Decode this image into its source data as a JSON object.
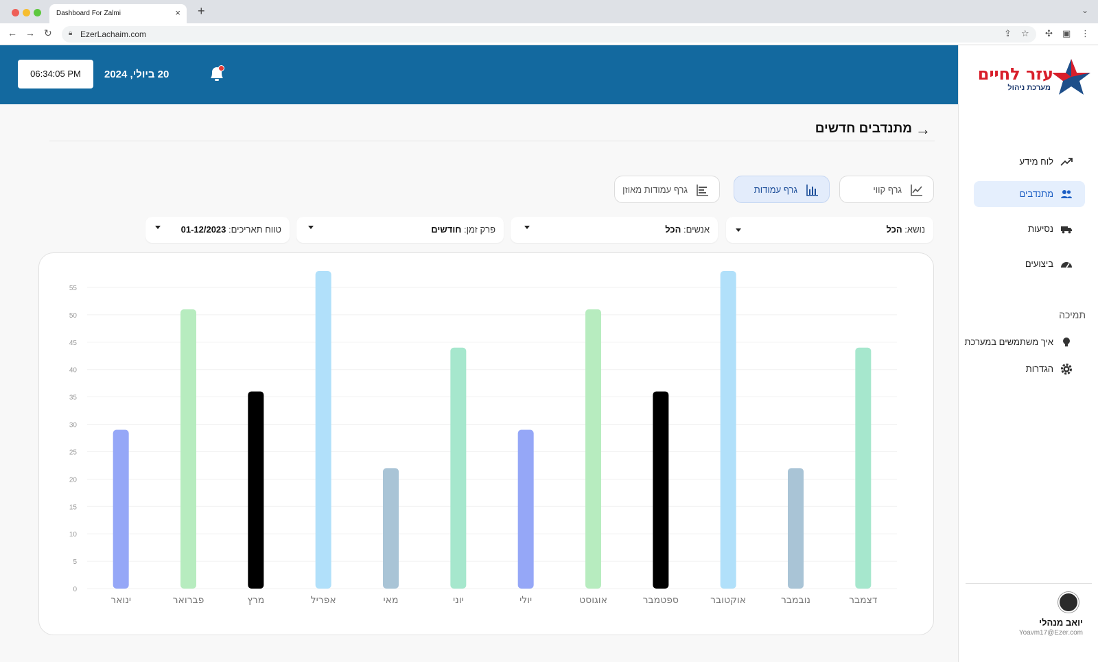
{
  "browser": {
    "tab_title": "Dashboard For Zalmi",
    "url": "EzerLachaim.com"
  },
  "sidebar": {
    "logo_text": "עזר לחיים",
    "logo_sub": "מערכת ניהול",
    "items": [
      {
        "label": "לוח מידע",
        "icon": "trend-icon",
        "active": false
      },
      {
        "label": "מתנדבים",
        "icon": "users-icon",
        "active": true
      },
      {
        "label": "נסיעות",
        "icon": "truck-icon",
        "active": false
      },
      {
        "label": "ביצועים",
        "icon": "gauge-icon",
        "active": false
      }
    ],
    "support_heading": "תמיכה",
    "support_items": [
      {
        "label": "איך משתמשים במערכת",
        "icon": "lightbulb-icon"
      },
      {
        "label": "הגדרות",
        "icon": "gear-icon"
      }
    ],
    "user": {
      "name": "יואב מנהלי",
      "email": "Yoavm17@Ezer.com"
    }
  },
  "header": {
    "time": "06:34:05 PM",
    "date": "20 ביולי, 2024"
  },
  "page": {
    "title": "מתנדבים חדשים",
    "chart_toggles": [
      {
        "label": "גרף קווי",
        "icon": "line-chart-icon",
        "active": false
      },
      {
        "label": "גרף עמודות",
        "icon": "bar-chart-icon",
        "active": true
      },
      {
        "label": "גרף עמודות מאוזן",
        "icon": "horizontal-bar-chart-icon",
        "active": false
      }
    ],
    "filters": [
      {
        "label": "נושא:",
        "value": "הכל"
      },
      {
        "label": "אנשים:",
        "value": "הכל"
      },
      {
        "label": "פרק זמן:",
        "value": "חודשים"
      },
      {
        "label": "טווח תאריכים:",
        "value": "01-12/2023"
      }
    ]
  },
  "colors": {
    "header": "#13699f",
    "accent": "#1d5fc4",
    "bar_palette": [
      "#95a7f7",
      "#b7ecbf",
      "#000000",
      "#b1e0fa",
      "#a9c4d6",
      "#a6e7cd"
    ]
  },
  "chart_data": {
    "type": "bar",
    "categories": [
      "ינואר",
      "פברואר",
      "מרץ",
      "אפריל",
      "מאי",
      "יוני",
      "יולי",
      "אוגוסט",
      "ספטמבר",
      "אוקטובר",
      "נובמבר",
      "דצמבר"
    ],
    "values": [
      29,
      51,
      36,
      58,
      22,
      44,
      29,
      51,
      36,
      58,
      22,
      44
    ],
    "bar_colors": [
      "#95a7f7",
      "#b7ecbf",
      "#000000",
      "#b1e0fa",
      "#a9c4d6",
      "#a6e7cd",
      "#95a7f7",
      "#b7ecbf",
      "#000000",
      "#b1e0fa",
      "#a9c4d6",
      "#a6e7cd"
    ],
    "yticks": [
      0,
      5,
      10,
      15,
      20,
      25,
      30,
      35,
      40,
      45,
      50,
      55
    ],
    "ylim": [
      0,
      55
    ],
    "grid": true
  }
}
